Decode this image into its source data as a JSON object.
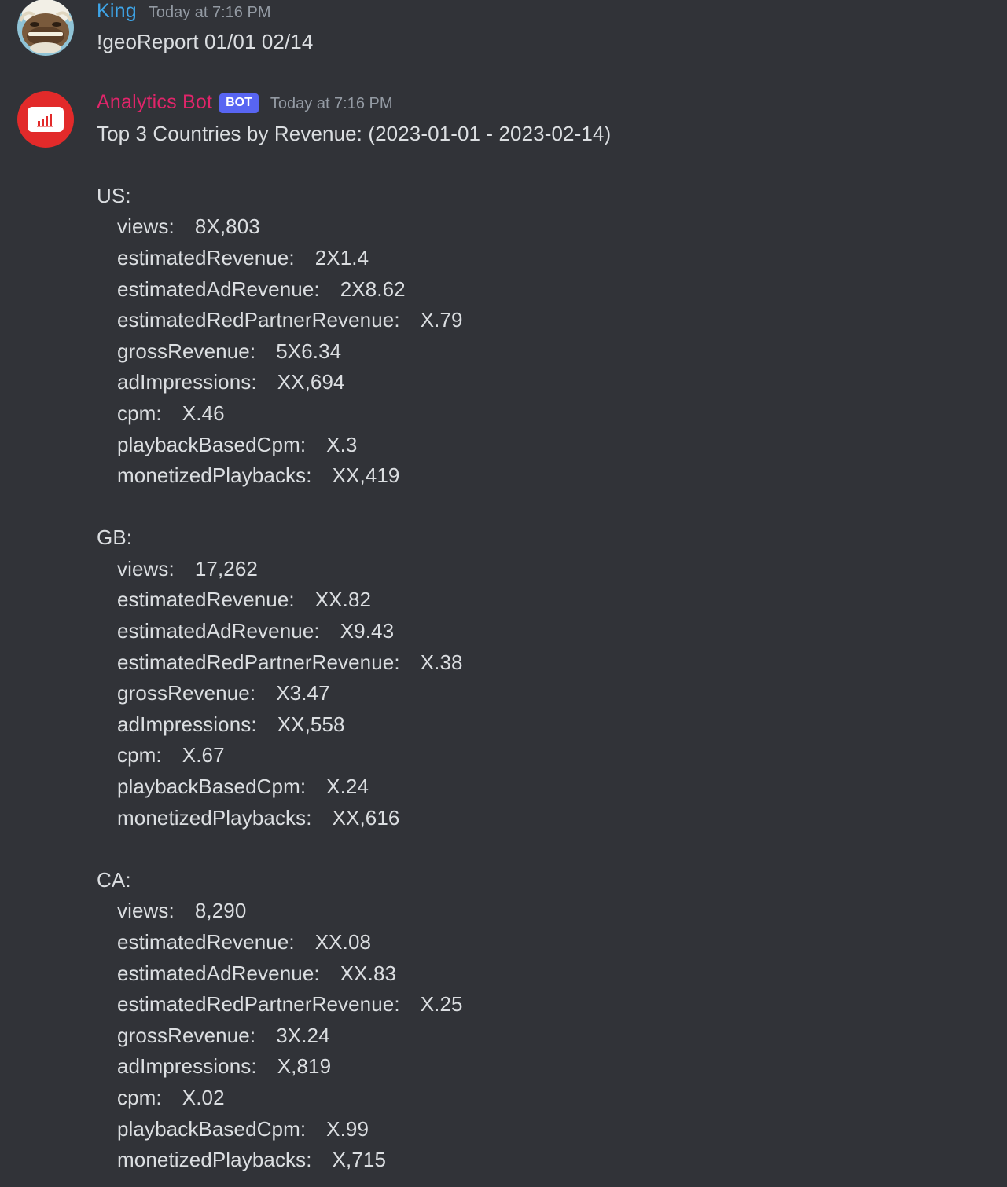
{
  "messages": {
    "user": {
      "username": "King",
      "username_color": "#3ea5e8",
      "timestamp": "Today at 7:16 PM",
      "avatar_icon": "bison-avatar-icon",
      "text": "!geoReport 01/01 02/14"
    },
    "bot": {
      "username": "Analytics Bot",
      "username_color": "#e0256a",
      "bot_tag": "BOT",
      "timestamp": "Today at 7:16 PM",
      "avatar_icon": "bar-chart-icon",
      "title": "Top 3 Countries by Revenue: (2023-01-01 - 2023-02-14)",
      "countries": [
        {
          "code": "US:",
          "metrics": [
            {
              "label": "views:",
              "value": "8X,803"
            },
            {
              "label": "estimatedRevenue:",
              "value": "2X1.4"
            },
            {
              "label": "estimatedAdRevenue:",
              "value": "2X8.62"
            },
            {
              "label": "estimatedRedPartnerRevenue:",
              "value": "X.79"
            },
            {
              "label": "grossRevenue:",
              "value": "5X6.34"
            },
            {
              "label": "adImpressions:",
              "value": "XX,694"
            },
            {
              "label": "cpm:",
              "value": "X.46"
            },
            {
              "label": "playbackBasedCpm:",
              "value": "X.3"
            },
            {
              "label": "monetizedPlaybacks:",
              "value": "XX,419"
            }
          ]
        },
        {
          "code": "GB:",
          "metrics": [
            {
              "label": "views:",
              "value": "17,262"
            },
            {
              "label": "estimatedRevenue:",
              "value": "XX.82"
            },
            {
              "label": "estimatedAdRevenue:",
              "value": "X9.43"
            },
            {
              "label": "estimatedRedPartnerRevenue:",
              "value": "X.38"
            },
            {
              "label": "grossRevenue:",
              "value": "X3.47"
            },
            {
              "label": "adImpressions:",
              "value": "XX,558"
            },
            {
              "label": "cpm:",
              "value": "X.67"
            },
            {
              "label": "playbackBasedCpm:",
              "value": "X.24"
            },
            {
              "label": "monetizedPlaybacks:",
              "value": "XX,616"
            }
          ]
        },
        {
          "code": "CA:",
          "metrics": [
            {
              "label": "views:",
              "value": "8,290"
            },
            {
              "label": "estimatedRevenue:",
              "value": "XX.08"
            },
            {
              "label": "estimatedAdRevenue:",
              "value": "XX.83"
            },
            {
              "label": "estimatedRedPartnerRevenue:",
              "value": "X.25"
            },
            {
              "label": "grossRevenue:",
              "value": "3X.24"
            },
            {
              "label": "adImpressions:",
              "value": "X,819"
            },
            {
              "label": "cpm:",
              "value": "X.02"
            },
            {
              "label": "playbackBasedCpm:",
              "value": "X.99"
            },
            {
              "label": "monetizedPlaybacks:",
              "value": "X,715"
            }
          ]
        }
      ]
    }
  }
}
